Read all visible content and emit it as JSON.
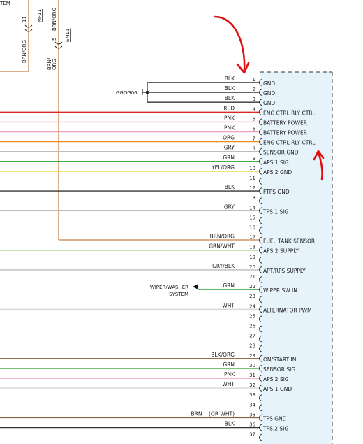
{
  "top_left": {
    "partial_label": "TEM",
    "branch_left": {
      "color_code": "BRN/ORG",
      "pin": "11",
      "connector": "MF11"
    },
    "branch_right": {
      "color_code": "BRN/ORG",
      "pin": "5",
      "connector": "EM11"
    }
  },
  "splice": {
    "label": "GGGG06"
  },
  "external": {
    "wiper_line1": "WIPER/WASHER",
    "wiper_line2": "SYSTEM"
  },
  "pins": [
    {
      "pin": "1",
      "color": "BLK",
      "function": "GND",
      "wire": "#333333"
    },
    {
      "pin": "2",
      "color": "BLK",
      "function": "GND",
      "wire": "#333333"
    },
    {
      "pin": "3",
      "color": "BLK",
      "function": "GND",
      "wire": "#333333"
    },
    {
      "pin": "4",
      "color": "RED",
      "function": "ENG CTRL RLY CTRL",
      "wire": "#d42a2a"
    },
    {
      "pin": "5",
      "color": "PNK",
      "function": "BATTERY POWER",
      "wire": "#f29fb2"
    },
    {
      "pin": "6",
      "color": "PNK",
      "function": "BATTERY POWER",
      "wire": "#f29fb2"
    },
    {
      "pin": "7",
      "color": "ORG",
      "function": "ENG CTRL RLY CTRL",
      "wire": "#f08a18"
    },
    {
      "pin": "8",
      "color": "GRY",
      "function": "SENSOR GND",
      "wire": "#bcbcbc"
    },
    {
      "pin": "9",
      "color": "GRN",
      "function": "APS 1 SIG",
      "wire": "#2aa12a"
    },
    {
      "pin": "10",
      "color": "YEL/ORG",
      "function": "APS 2 GND",
      "wire": "#f4d21a"
    },
    {
      "pin": "11",
      "color": "",
      "function": "",
      "wire": ""
    },
    {
      "pin": "12",
      "color": "BLK",
      "function": "FTPS GND",
      "wire": "#333333"
    },
    {
      "pin": "13",
      "color": "",
      "function": "",
      "wire": ""
    },
    {
      "pin": "14",
      "color": "GRY",
      "function": "TPS.1 SIG",
      "wire": "#bcbcbc"
    },
    {
      "pin": "15",
      "color": "",
      "function": "",
      "wire": ""
    },
    {
      "pin": "16",
      "color": "",
      "function": "",
      "wire": ""
    },
    {
      "pin": "17",
      "color": "BRN/ORG",
      "function": "FUEL TANK SENSOR",
      "wire": "#c2824a"
    },
    {
      "pin": "18",
      "color": "GRN/WHT",
      "function": "APS 2 SUPPLY",
      "wire": "#6cbf3f"
    },
    {
      "pin": "19",
      "color": "",
      "function": "",
      "wire": ""
    },
    {
      "pin": "20",
      "color": "GRY/BLK",
      "function": "APT/RPS SUPPLY",
      "wire": "#bcbcbc"
    },
    {
      "pin": "21",
      "color": "",
      "function": "",
      "wire": ""
    },
    {
      "pin": "22",
      "color": "GRN",
      "function": "WIPER SW IN",
      "wire": "#2aa12a"
    },
    {
      "pin": "23",
      "color": "",
      "function": "",
      "wire": ""
    },
    {
      "pin": "24",
      "color": "WHT",
      "function": "ALTERNATOR PWM",
      "wire": "#d6d6d6"
    },
    {
      "pin": "25",
      "color": "",
      "function": "",
      "wire": ""
    },
    {
      "pin": "26",
      "color": "",
      "function": "",
      "wire": ""
    },
    {
      "pin": "27",
      "color": "",
      "function": "",
      "wire": ""
    },
    {
      "pin": "28",
      "color": "",
      "function": "",
      "wire": ""
    },
    {
      "pin": "29",
      "color": "BLK/ORG",
      "function": "ON/START IN",
      "wire": "#8a5a2a"
    },
    {
      "pin": "30",
      "color": "GRN",
      "function": "SENSOR SIG",
      "wire": "#2aa12a"
    },
    {
      "pin": "31",
      "color": "PNK",
      "function": "APS 2 SIG",
      "wire": "#f29fb2"
    },
    {
      "pin": "32",
      "color": "WHT",
      "function": "APS 1 GND",
      "wire": "#d6d6d6"
    },
    {
      "pin": "33",
      "color": "",
      "function": "",
      "wire": ""
    },
    {
      "pin": "34",
      "color": "",
      "function": "",
      "wire": ""
    },
    {
      "pin": "35",
      "color": "BRN    (OR WHT)",
      "function": "TPS GND",
      "wire": "#8a6236"
    },
    {
      "pin": "36",
      "color": "BLK",
      "function": "TPS.2 SIG",
      "wire": "#333333"
    },
    {
      "pin": "37",
      "color": "",
      "function": "",
      "wire": ""
    }
  ]
}
